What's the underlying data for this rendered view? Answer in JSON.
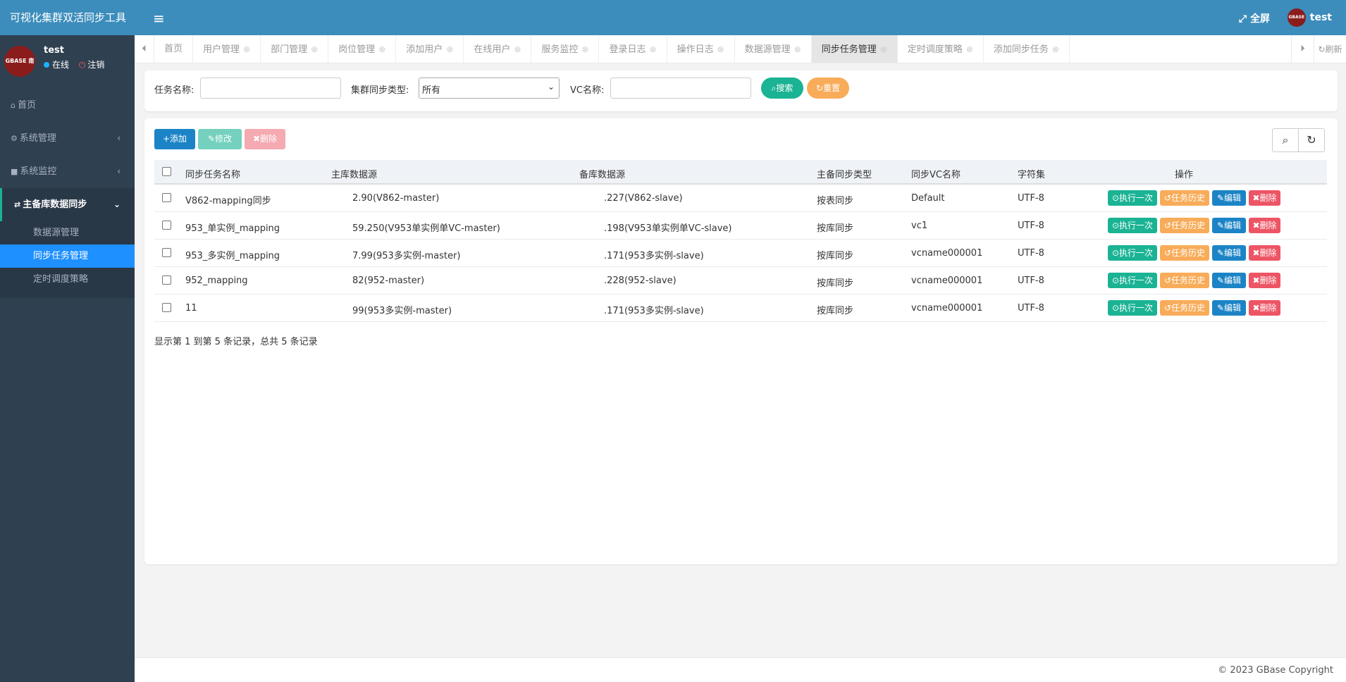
{
  "app": {
    "title": "可视化集群双活同步工具",
    "fullscreen": "全屏",
    "user": "test",
    "footer": "© 2023 GBase Copyright"
  },
  "user_panel": {
    "name": "test",
    "status": "在线",
    "logout": "注销",
    "avatar_text": "GBASE 南大通用"
  },
  "sidebar": {
    "items": [
      {
        "label": "首页"
      },
      {
        "label": "系统管理"
      },
      {
        "label": "系统监控"
      },
      {
        "label": "主备库数据同步"
      }
    ],
    "sub_items": [
      {
        "label": "数据源管理"
      },
      {
        "label": "同步任务管理"
      },
      {
        "label": "定时调度策略"
      }
    ]
  },
  "tabs": [
    {
      "label": "首页"
    },
    {
      "label": "用户管理"
    },
    {
      "label": "部门管理"
    },
    {
      "label": "岗位管理"
    },
    {
      "label": "添加用户"
    },
    {
      "label": "在线用户"
    },
    {
      "label": "服务监控"
    },
    {
      "label": "登录日志"
    },
    {
      "label": "操作日志"
    },
    {
      "label": "数据源管理"
    },
    {
      "label": "同步任务管理"
    },
    {
      "label": "定时调度策略"
    },
    {
      "label": "添加同步任务"
    }
  ],
  "tabs_refresh": "刷新",
  "search": {
    "task_name_label": "任务名称:",
    "sync_type_label": "集群同步类型:",
    "sync_type_value": "所有",
    "vc_label": "VC名称:",
    "search_btn": "搜索",
    "reset_btn": "重置"
  },
  "toolbar": {
    "add": "添加",
    "edit": "修改",
    "delete": "删除"
  },
  "table": {
    "headers": [
      "同步任务名称",
      "主库数据源",
      "备库数据源",
      "主备同步类型",
      "同步VC名称",
      "字符集",
      "操作"
    ],
    "rows": [
      {
        "name": "V862-mapping同步",
        "master": "2.90(V862-master)",
        "slave": ".227(V862-slave)",
        "type": "按表同步",
        "vc": "Default",
        "charset": "UTF-8"
      },
      {
        "name": "953_单实例_mapping",
        "master": "59.250(V953单实例单VC-master)",
        "slave": ".198(V953单实例单VC-slave)",
        "type": "按库同步",
        "vc": "vc1",
        "charset": "UTF-8"
      },
      {
        "name": "953_多实例_mapping",
        "master": "7.99(953多实例-master)",
        "slave": ".171(953多实例-slave)",
        "type": "按库同步",
        "vc": "vcname000001",
        "charset": "UTF-8"
      },
      {
        "name": "952_mapping",
        "master": "82(952-master)",
        "slave": ".228(952-slave)",
        "type": "按库同步",
        "vc": "vcname000001",
        "charset": "UTF-8"
      },
      {
        "name": "11",
        "master": "99(953多实例-master)",
        "slave": ".171(953多实例-slave)",
        "type": "按库同步",
        "vc": "vcname000001",
        "charset": "UTF-8"
      }
    ],
    "actions": {
      "run": "执行一次",
      "history": "任务历史",
      "edit": "编辑",
      "delete": "删除"
    }
  },
  "summary": "显示第 1 到第 5 条记录，总共 5 条记录",
  "colors": {
    "sidebar": "#2f4050",
    "topbar": "#3c8dbc",
    "green": "#1ab394",
    "orange": "#f8ac59",
    "blue": "#1c84c6",
    "red": "#ed5565",
    "active_sub": "#1e90ff"
  }
}
